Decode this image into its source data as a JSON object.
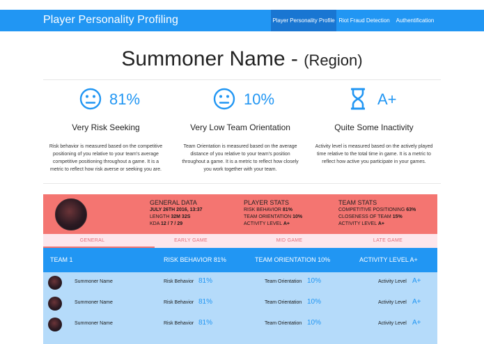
{
  "navbar": {
    "brand": "Player Personality Profiling",
    "items": [
      {
        "label": "Player Personality Profile",
        "active": true
      },
      {
        "label": "Riot Fraud Detection",
        "active": false
      },
      {
        "label": "Authentification",
        "active": false
      }
    ]
  },
  "header": {
    "summoner": "Summoner Name",
    "separator": "-",
    "region": "(Region)"
  },
  "stats": [
    {
      "icon": "sad-face-icon",
      "value": "81%",
      "label": "Very Risk Seeking",
      "description": "Risk behavior is measured based on the competitive positioning of you relative to your team's average competitive positioning throughout a game. It is a metric to reflect how risk averse or seeking you are."
    },
    {
      "icon": "sad-face-icon",
      "value": "10%",
      "label": "Very Low Team Orientation",
      "description": "Team Orientation is measured based on the average distance of you relative to your team's position throughout a game. It is a metric to reflect how closely you work together with your team."
    },
    {
      "icon": "hourglass-icon",
      "value": "A+",
      "label": "Quite Some Inactivity",
      "description": "Activity level is measured based on the actively played time relative to the total time in game. It is a metric to reflect how active you participate in your games."
    }
  ],
  "game": {
    "general": {
      "title": "GENERAL DATA",
      "date": "JULY 26TH 2016, 13:37",
      "length_label": "LENGTH",
      "length_value": "32M 32S",
      "kda_label": "KDA",
      "kda_value": "12 / 7 / 29"
    },
    "player": {
      "title": "PLAYER STATS",
      "rows": [
        {
          "label": "RISK BEHAVIOR",
          "value": "81%"
        },
        {
          "label": "TEAM ORIENTATION",
          "value": "10%"
        },
        {
          "label": "ACTIVITY LEVEL",
          "value": "A+"
        }
      ]
    },
    "team": {
      "title": "TEAM STATS",
      "rows": [
        {
          "label": "COMPETITIVE POSITIONING",
          "value": "63%"
        },
        {
          "label": "CLOSENESS OF TEAM",
          "value": "15%"
        },
        {
          "label": "ACTIVITY LEVEL",
          "value": "A+"
        }
      ]
    }
  },
  "tabs": [
    {
      "label": "GENERAL",
      "active": true
    },
    {
      "label": "EARLY GAME",
      "active": false
    },
    {
      "label": "MID GAME",
      "active": false
    },
    {
      "label": "LATE GAME",
      "active": false
    }
  ],
  "team_table": {
    "headers": [
      "TEAM 1",
      "RISK BEHAVIOR 81%",
      "TEAM ORIENTATION 10%",
      "ACTIVITY LEVEL A+"
    ],
    "rows": [
      {
        "name": "Summoner Name",
        "risk_label": "Risk Behavior",
        "risk": "81%",
        "team_label": "Team Orientation",
        "team": "10%",
        "activity_label": "Activity Level",
        "activity": "A+"
      },
      {
        "name": "Summoner Name",
        "risk_label": "Risk Behavior",
        "risk": "81%",
        "team_label": "Team Orientation",
        "team": "10%",
        "activity_label": "Activity Level",
        "activity": "A+"
      },
      {
        "name": "Summoner Name",
        "risk_label": "Risk Behavior",
        "risk": "81%",
        "team_label": "Team Orientation",
        "team": "10%",
        "activity_label": "Activity Level",
        "activity": "A+"
      }
    ]
  },
  "colors": {
    "primary": "#2196f3",
    "primary_dark": "#1976d2",
    "card_red": "#f47571",
    "tab_pink": "#fde6ec",
    "row_blue": "#b5dbfa"
  }
}
